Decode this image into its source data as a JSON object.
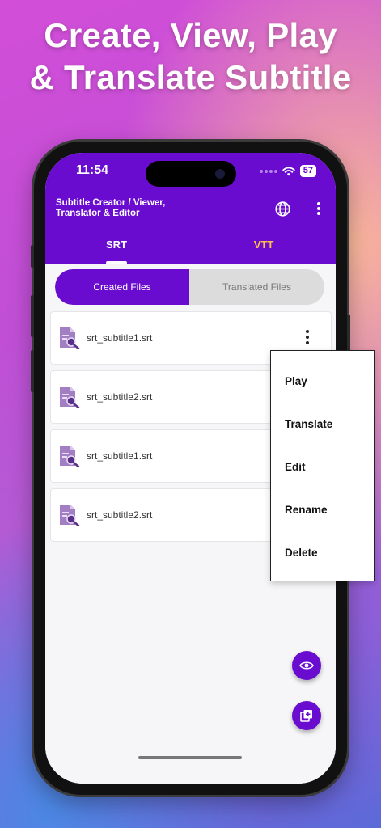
{
  "promo": {
    "line1": "Create, View, Play",
    "line2": "& Translate Subtitle"
  },
  "status_bar": {
    "time": "11:54",
    "battery": "57"
  },
  "app": {
    "title_line1": "Subtitle Creator / Viewer,",
    "title_line2": "Translator & Editor",
    "accent_color": "#6a0bd0",
    "tab_highlight_color": "#ffc04a"
  },
  "tabs": [
    {
      "label": "SRT",
      "selected": true
    },
    {
      "label": "VTT",
      "selected": false
    }
  ],
  "segment": {
    "created_label": "Created Files",
    "translated_label": "Translated Files"
  },
  "files": [
    {
      "name": "srt_subtitle1.srt"
    },
    {
      "name": "srt_subtitle2.srt"
    },
    {
      "name": "srt_subtitle1.srt"
    },
    {
      "name": "srt_subtitle2.srt"
    }
  ],
  "context_menu": {
    "items": [
      "Play",
      "Translate",
      "Edit",
      "Rename",
      "Delete"
    ]
  },
  "icons": {
    "language": "globe-icon",
    "overflow": "more-vertical-icon",
    "file": "subtitle-file-search-icon",
    "view_fab": "eye-icon",
    "add_fab": "add-file-icon"
  }
}
